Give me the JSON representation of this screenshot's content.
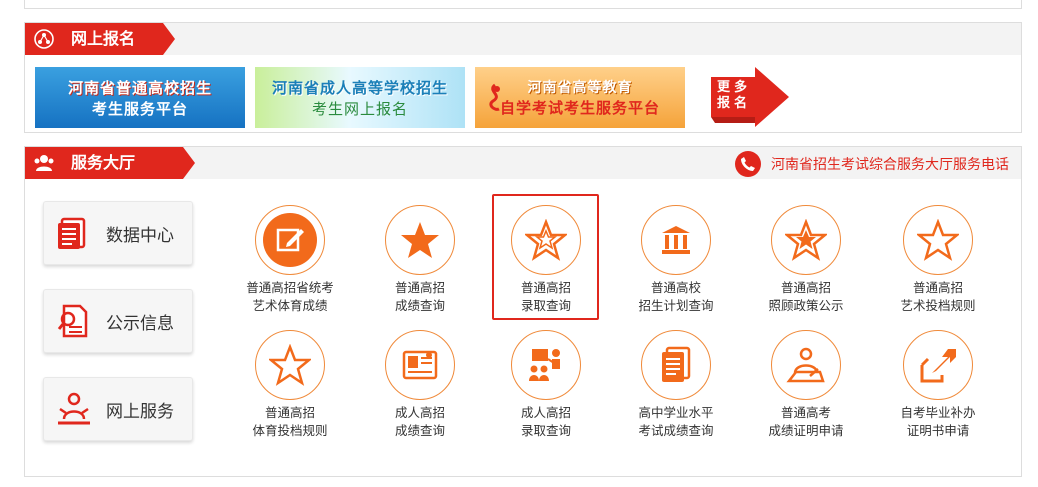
{
  "registration": {
    "title": "网上报名",
    "banners": [
      {
        "line1": "河南省普通高校招生",
        "line2": "考生服务平台"
      },
      {
        "line1": "河南省成人高等学校招生",
        "line2": "考生网上报名"
      },
      {
        "line1": "河南省高等教育",
        "line2": "自学考试考生服务平台"
      }
    ],
    "more_label": "更多报名"
  },
  "service_hall": {
    "title": "服务大厅",
    "phone_text": "河南省招生考试综合服务大厅服务电话",
    "side_buttons": [
      {
        "label": "数据中心",
        "icon": "document-stack-icon"
      },
      {
        "label": "公示信息",
        "icon": "document-search-icon"
      },
      {
        "label": "网上服务",
        "icon": "person-service-icon"
      }
    ],
    "services": [
      {
        "line1": "普通高招省统考",
        "line2": "艺术体育成绩",
        "icon": "edit-icon"
      },
      {
        "line1": "普通高招",
        "line2": "成绩查询",
        "icon": "star-solid-icon"
      },
      {
        "line1": "普通高招",
        "line2": "录取查询",
        "icon": "star-outline-icon"
      },
      {
        "line1": "普通高校",
        "line2": "招生计划查询",
        "icon": "institution-icon"
      },
      {
        "line1": "普通高招",
        "line2": "照顾政策公示",
        "icon": "star-badge-icon"
      },
      {
        "line1": "普通高招",
        "line2": "艺术投档规则",
        "icon": "star-outline-icon"
      },
      {
        "line1": "普通高招",
        "line2": "体育投档规则",
        "icon": "star-outline-icon"
      },
      {
        "line1": "成人高招",
        "line2": "成绩查询",
        "icon": "certificate-icon"
      },
      {
        "line1": "成人高招",
        "line2": "录取查询",
        "icon": "presentation-icon"
      },
      {
        "line1": "高中学业水平",
        "line2": "考试成绩查询",
        "icon": "document-list-icon"
      },
      {
        "line1": "普通高考",
        "line2": "成绩证明申请",
        "icon": "writing-person-icon"
      },
      {
        "line1": "自考毕业补办",
        "line2": "证明书申请",
        "icon": "external-arrow-icon"
      }
    ]
  },
  "colors": {
    "accent": "#e0271d",
    "icon_orange": "#f26a1b",
    "head_bg": "#f3f3f3"
  }
}
